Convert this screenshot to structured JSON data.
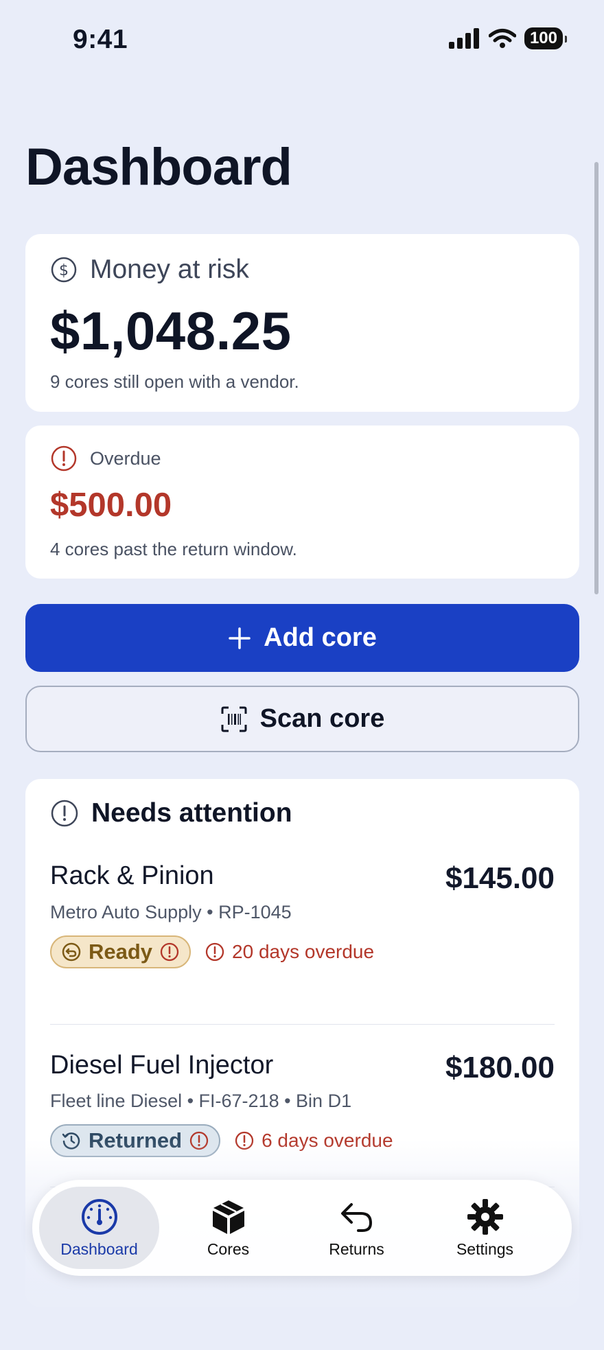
{
  "status_bar": {
    "time": "9:41",
    "battery": "100"
  },
  "page": {
    "title": "Dashboard"
  },
  "money_at_risk": {
    "label": "Money at risk",
    "amount": "$1,048.25",
    "note": "9 cores still open with a vendor."
  },
  "overdue": {
    "label": "Overdue",
    "amount": "$500.00",
    "note": "4 cores past the return window."
  },
  "actions": {
    "add_core_label": "Add core",
    "scan_core_label": "Scan core"
  },
  "needs_attention": {
    "title": "Needs attention",
    "items": [
      {
        "name": "Rack & Pinion",
        "meta": "Metro Auto Supply • RP-1045",
        "price": "$145.00",
        "status": "Ready",
        "overdue": "20 days overdue"
      },
      {
        "name": "Diesel Fuel Injector",
        "meta": "Fleet line Diesel • FI-67-218 • Bin D1",
        "price": "$180.00",
        "status": "Returned",
        "overdue": "6 days overdue"
      }
    ]
  },
  "tabs": [
    {
      "label": "Dashboard",
      "icon": "gauge-icon",
      "active": true
    },
    {
      "label": "Cores",
      "icon": "box-icon",
      "active": false
    },
    {
      "label": "Returns",
      "icon": "return-arrow-icon",
      "active": false
    },
    {
      "label": "Settings",
      "icon": "gear-icon",
      "active": false
    }
  ],
  "colors": {
    "background": "#e9edf9",
    "primary": "#1a40c4",
    "danger": "#b3372a",
    "ready_pill": "#f5e6c9",
    "returned_pill": "#dde6ee"
  }
}
